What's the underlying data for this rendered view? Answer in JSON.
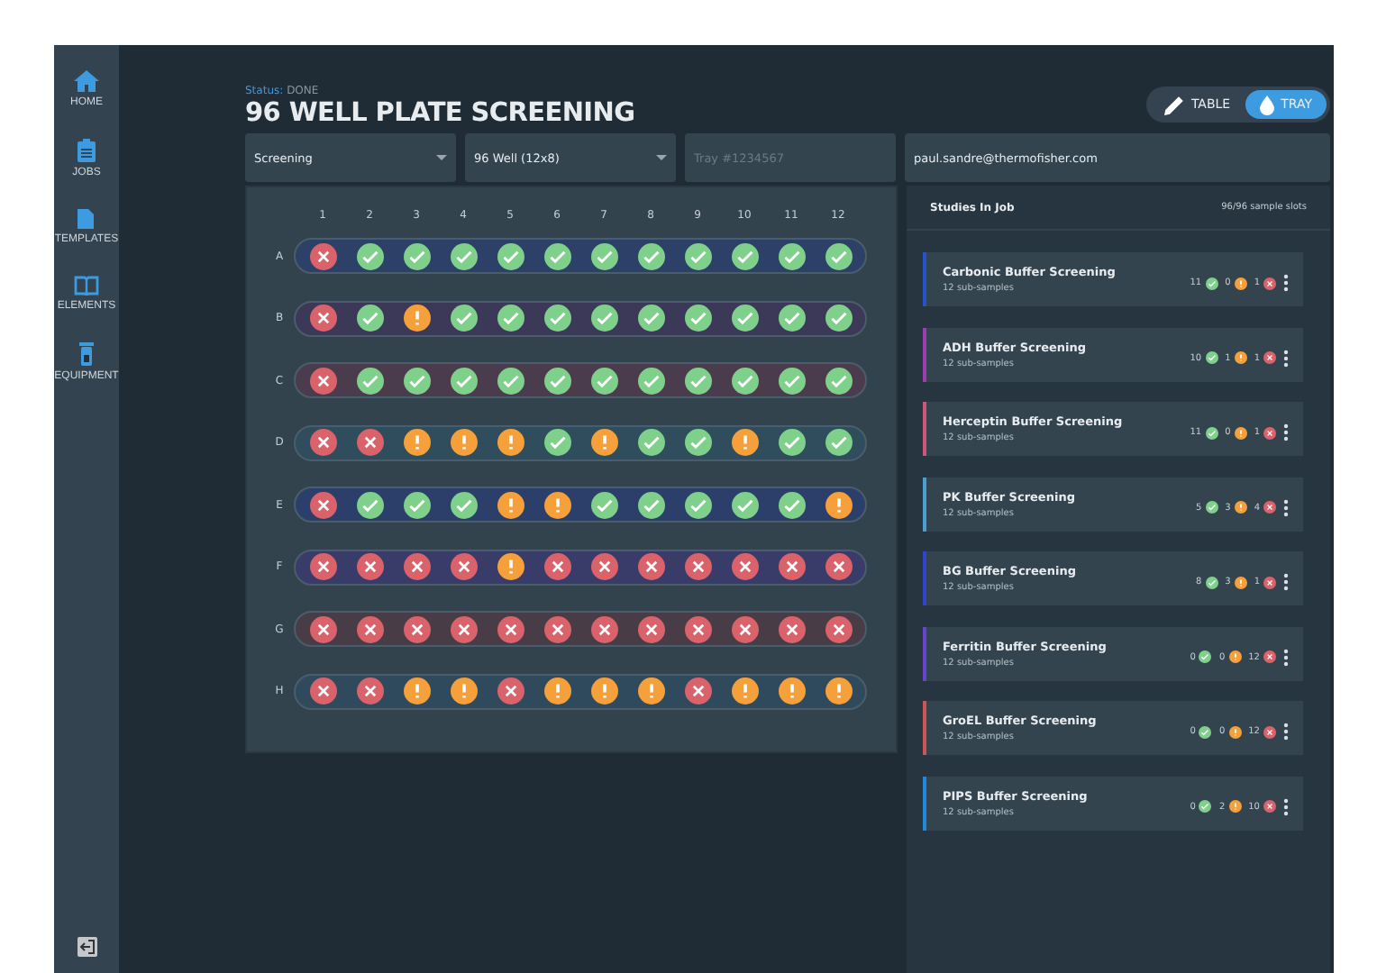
{
  "sidebar": {
    "items": [
      {
        "label": "HOME"
      },
      {
        "label": "JOBS"
      },
      {
        "label": "TEMPLATES"
      },
      {
        "label": "ELEMENTS"
      },
      {
        "label": "EQUIPMENT"
      }
    ]
  },
  "header": {
    "status_label": "Status:",
    "status": "DONE",
    "title": "96 WELL PLATE SCREENING",
    "view_toggle": [
      {
        "label": "TABLE",
        "selected": false
      },
      {
        "label": "TRAY",
        "selected": true
      }
    ]
  },
  "fields": [
    {
      "kind": "select",
      "value": "Screening"
    },
    {
      "kind": "select",
      "value": "96 Well (12x8)"
    },
    {
      "kind": "text",
      "placeholder": "Tray #1234567"
    },
    {
      "kind": "text",
      "value": "paul.sandre@thermofisher.com"
    }
  ],
  "plate": {
    "columns": [
      "1",
      "2",
      "3",
      "4",
      "5",
      "6",
      "7",
      "8",
      "9",
      "10",
      "11",
      "12"
    ],
    "rows": [
      {
        "label": "A",
        "color": "#2c4068",
        "wells": [
          {
            "kind": "fail"
          },
          {
            "kind": "ok"
          },
          {
            "kind": "ok"
          },
          {
            "kind": "ok"
          },
          {
            "kind": "ok"
          },
          {
            "kind": "ok"
          },
          {
            "kind": "ok"
          },
          {
            "kind": "ok"
          },
          {
            "kind": "ok"
          },
          {
            "kind": "ok"
          },
          {
            "kind": "ok"
          },
          {
            "kind": "ok"
          }
        ]
      },
      {
        "label": "B",
        "color": "#3b3858",
        "wells": [
          {
            "kind": "fail"
          },
          {
            "kind": "ok"
          },
          {
            "kind": "warn"
          },
          {
            "kind": "ok"
          },
          {
            "kind": "ok"
          },
          {
            "kind": "ok"
          },
          {
            "kind": "ok"
          },
          {
            "kind": "ok"
          },
          {
            "kind": "ok"
          },
          {
            "kind": "ok"
          },
          {
            "kind": "ok"
          },
          {
            "kind": "ok"
          }
        ]
      },
      {
        "label": "C",
        "color": "#4a3c4c",
        "wells": [
          {
            "kind": "fail"
          },
          {
            "kind": "ok"
          },
          {
            "kind": "ok"
          },
          {
            "kind": "ok"
          },
          {
            "kind": "ok"
          },
          {
            "kind": "ok"
          },
          {
            "kind": "ok"
          },
          {
            "kind": "ok"
          },
          {
            "kind": "ok"
          },
          {
            "kind": "ok"
          },
          {
            "kind": "ok"
          },
          {
            "kind": "ok"
          }
        ]
      },
      {
        "label": "D",
        "color": "#2f4d5c",
        "wells": [
          {
            "kind": "fail"
          },
          {
            "kind": "fail"
          },
          {
            "kind": "warn"
          },
          {
            "kind": "warn"
          },
          {
            "kind": "warn"
          },
          {
            "kind": "ok"
          },
          {
            "kind": "warn"
          },
          {
            "kind": "ok"
          },
          {
            "kind": "ok"
          },
          {
            "kind": "warn"
          },
          {
            "kind": "ok"
          },
          {
            "kind": "ok"
          }
        ]
      },
      {
        "label": "E",
        "color": "#2c3f6a",
        "wells": [
          {
            "kind": "fail"
          },
          {
            "kind": "ok"
          },
          {
            "kind": "ok"
          },
          {
            "kind": "ok"
          },
          {
            "kind": "warn"
          },
          {
            "kind": "warn"
          },
          {
            "kind": "ok"
          },
          {
            "kind": "ok"
          },
          {
            "kind": "ok"
          },
          {
            "kind": "ok"
          },
          {
            "kind": "ok"
          },
          {
            "kind": "warn"
          }
        ]
      },
      {
        "label": "F",
        "color": "#393b68",
        "wells": [
          {
            "kind": "fail"
          },
          {
            "kind": "fail"
          },
          {
            "kind": "fail"
          },
          {
            "kind": "fail"
          },
          {
            "kind": "warn"
          },
          {
            "kind": "fail"
          },
          {
            "kind": "fail"
          },
          {
            "kind": "fail"
          },
          {
            "kind": "fail"
          },
          {
            "kind": "fail"
          },
          {
            "kind": "fail"
          },
          {
            "kind": "fail"
          }
        ]
      },
      {
        "label": "G",
        "color": "#483d47",
        "wells": [
          {
            "kind": "fail"
          },
          {
            "kind": "fail"
          },
          {
            "kind": "fail"
          },
          {
            "kind": "fail"
          },
          {
            "kind": "fail"
          },
          {
            "kind": "fail"
          },
          {
            "kind": "fail"
          },
          {
            "kind": "fail"
          },
          {
            "kind": "fail"
          },
          {
            "kind": "fail"
          },
          {
            "kind": "fail"
          },
          {
            "kind": "fail"
          }
        ]
      },
      {
        "label": "H",
        "color": "#2e4a5c",
        "wells": [
          {
            "kind": "fail"
          },
          {
            "kind": "fail"
          },
          {
            "kind": "warn"
          },
          {
            "kind": "warn"
          },
          {
            "kind": "fail"
          },
          {
            "kind": "warn"
          },
          {
            "kind": "warn"
          },
          {
            "kind": "warn"
          },
          {
            "kind": "fail"
          },
          {
            "kind": "warn"
          },
          {
            "kind": "warn"
          },
          {
            "kind": "warn"
          }
        ]
      }
    ]
  },
  "studies": {
    "title": "Studies In Job",
    "slots": "96/96 sample slots",
    "items": [
      {
        "name": "Carbonic Buffer Screening",
        "sub": "12 sub-samples",
        "color": "#2255cc",
        "ok": "11",
        "warn": "0",
        "fail": "1"
      },
      {
        "name": "ADH Buffer Screening",
        "sub": "12 sub-samples",
        "color": "#9a3fb0",
        "ok": "10",
        "warn": "1",
        "fail": "1"
      },
      {
        "name": "Herceptin Buffer Screening",
        "sub": "12 sub-samples",
        "color": "#d0557a",
        "ok": "11",
        "warn": "0",
        "fail": "1"
      },
      {
        "name": "PK Buffer Screening",
        "sub": "12 sub-samples",
        "color": "#4aa0d0",
        "ok": "5",
        "warn": "3",
        "fail": "4"
      },
      {
        "name": "BG Buffer Screening",
        "sub": "12 sub-samples",
        "color": "#3344cc",
        "ok": "8",
        "warn": "3",
        "fail": "1"
      },
      {
        "name": "Ferritin Buffer Screening",
        "sub": "12 sub-samples",
        "color": "#6644cc",
        "ok": "0",
        "warn": "0",
        "fail": "12"
      },
      {
        "name": "GroEL Buffer Screening",
        "sub": "12 sub-samples",
        "color": "#cc5555",
        "ok": "0",
        "warn": "0",
        "fail": "12"
      },
      {
        "name": "PIPS Buffer Screening",
        "sub": "12 sub-samples",
        "color": "#2288dd",
        "ok": "0",
        "warn": "2",
        "fail": "10"
      }
    ]
  }
}
